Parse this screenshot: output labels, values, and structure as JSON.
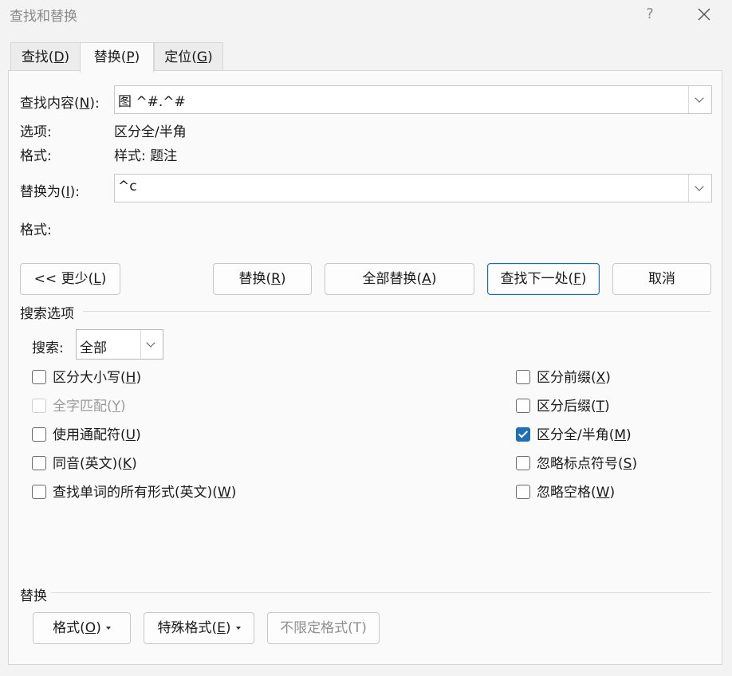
{
  "window": {
    "title": "查找和替换",
    "help": "?",
    "close": "✕"
  },
  "tabs": [
    {
      "label": "查找(",
      "key": "D",
      "end": ")"
    },
    {
      "label": "替换(",
      "key": "P",
      "end": ")"
    },
    {
      "label": "定位(",
      "key": "G",
      "end": ")"
    }
  ],
  "find": {
    "label_pre": "查找内容(",
    "label_key": "N",
    "label_post": "):",
    "value": "图 ^#.^#",
    "options_label": "选项:",
    "options_value": "区分全/半角",
    "format_label": "格式:",
    "format_value": "样式: 题注"
  },
  "replace": {
    "label_pre": "替换为(",
    "label_key": "I",
    "label_post": "):",
    "value": "^c",
    "format_label": "格式:"
  },
  "buttons": {
    "less": {
      "pre": "<< 更少(",
      "key": "L",
      "post": ")"
    },
    "replace": {
      "pre": "替换(",
      "key": "R",
      "post": ")"
    },
    "replace_all": {
      "pre": "全部替换(",
      "key": "A",
      "post": ")"
    },
    "find_next": {
      "pre": "查找下一处(",
      "key": "F",
      "post": ")"
    },
    "cancel": "取消"
  },
  "search_options": {
    "title": "搜索选项",
    "search_label_pre": "搜索",
    "search_label_post": ":",
    "search_value": "全部",
    "left": [
      {
        "pre": "区分大小写(",
        "key": "H",
        "post": ")",
        "checked": false,
        "disabled": false
      },
      {
        "pre": "全字匹配(",
        "key": "Y",
        "post": ")",
        "checked": false,
        "disabled": true
      },
      {
        "pre": "使用通配符(",
        "key": "U",
        "post": ")",
        "checked": false,
        "disabled": false
      },
      {
        "pre": "同音(英文)(",
        "key": "K",
        "post": ")",
        "checked": false,
        "disabled": false
      },
      {
        "pre": "查找单词的所有形式(英文)(",
        "key": "W",
        "post": ")",
        "checked": false,
        "disabled": false
      }
    ],
    "right": [
      {
        "pre": "区分前缀(",
        "key": "X",
        "post": ")",
        "checked": false,
        "disabled": false
      },
      {
        "pre": "区分后缀(",
        "key": "T",
        "post": ")",
        "checked": false,
        "disabled": false
      },
      {
        "pre": "区分全/半角(",
        "key": "M",
        "post": ")",
        "checked": true,
        "disabled": false
      },
      {
        "pre": "忽略标点符号(",
        "key": "S",
        "post": ")",
        "checked": false,
        "disabled": false
      },
      {
        "pre": "忽略空格(",
        "key": "W",
        "post": ")",
        "checked": false,
        "disabled": false
      }
    ]
  },
  "replace_section": {
    "title": "替换",
    "format_btn": {
      "pre": "格式(",
      "key": "O",
      "post": ")"
    },
    "special_btn": {
      "pre": "特殊格式(",
      "key": "E",
      "post": ")"
    },
    "no_format_btn": "不限定格式(T)"
  },
  "colors": {
    "accent": "#1f6fb4",
    "primary_border": "#1f6f9f"
  }
}
